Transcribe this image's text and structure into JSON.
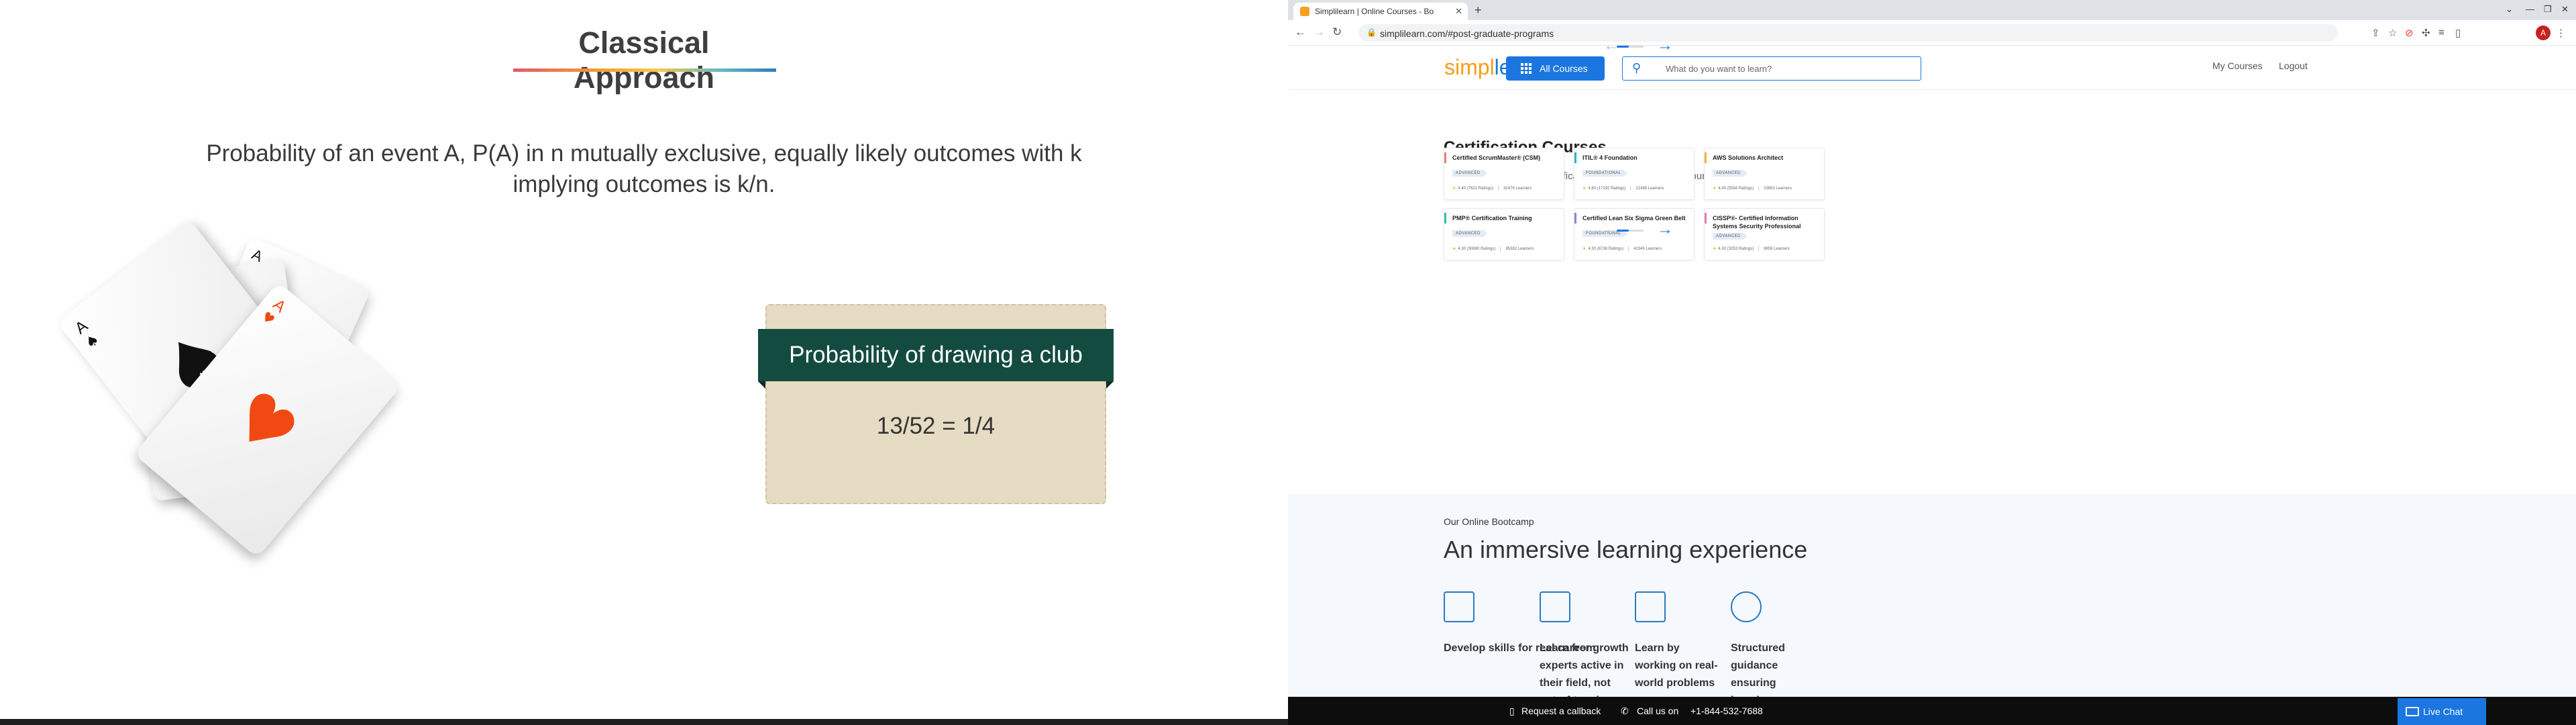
{
  "slide": {
    "title": "Classical Approach",
    "description": "Probability of an event A, P(A) in n mutually exclusive, equally likely outcomes with k implying outcomes is k/n.",
    "ribbon": "Probability of drawing a club",
    "value": "13/52 = 1/4",
    "card_letter": "A"
  },
  "browser": {
    "tab_title": "Simplilearn | Online Courses - Bo",
    "url": "simplilearn.com/#post-graduate-programs"
  },
  "site": {
    "logo_part1": "simpl",
    "logo_part2": "learn",
    "all_courses": "All Courses",
    "search_placeholder": "What do you want to learn?",
    "my_courses": "My Courses",
    "logout": "Logout"
  },
  "certification": {
    "title": "Certification Courses",
    "subtitle": "Get certified by global certification bodies and deepen your expertise",
    "cards": [
      {
        "title": "Certified ScrumMaster® (CSM)",
        "level": "ADVANCED",
        "rating": "4.40 (7621 Ratings)",
        "learners": "32476 Learners",
        "accent": "#ef7b7b"
      },
      {
        "title": "ITIL® 4 Foundation",
        "level": "FOUNDATIONAL",
        "rating": "4.60 (17192 Ratings)",
        "learners": "21498 Learners",
        "accent": "#2bb4c9"
      },
      {
        "title": "AWS Solutions Architect",
        "level": "ADVANCED",
        "rating": "4.40 (5594 Ratings)",
        "learners": "23653 Learners",
        "accent": "#f5b335"
      },
      {
        "title": "PMP® Certification Training",
        "level": "ADVANCED",
        "rating": "4.30 (30890 Ratings)",
        "learners": "95382 Learners",
        "accent": "#2fc3a8"
      },
      {
        "title": "Certified Lean Six Sigma Green Belt",
        "level": "FOUNDATIONAL",
        "rating": "4.30 (8738 Ratings)",
        "learners": "42345 Learners",
        "accent": "#9a7ce0"
      },
      {
        "title": "CISSP®- Certified Information Systems Security Professional",
        "level": "ADVANCED",
        "rating": "4.30 (3253 Ratings)",
        "learners": "9858 Learners",
        "accent": "#ef7bb0"
      }
    ]
  },
  "bootcamp": {
    "kicker": "Our Online Bootcamp",
    "title": "An immersive learning experience",
    "features": [
      {
        "text": "Develop skills for real career growth",
        "icon": "briefcase-icon"
      },
      {
        "text": "Learn from experts active in their field, not out-of-touch trainers",
        "icon": "presentation-icon"
      },
      {
        "text": "Learn by working on real-world problems",
        "icon": "screen-icon"
      },
      {
        "text": "Structured guidance ensuring learning never stops",
        "icon": "clock-247-icon"
      }
    ]
  },
  "bottom_bar": {
    "callback": "Request a callback",
    "call_label": "Call us on",
    "phone": "+1-844-532-7688",
    "chat": "Live Chat"
  }
}
